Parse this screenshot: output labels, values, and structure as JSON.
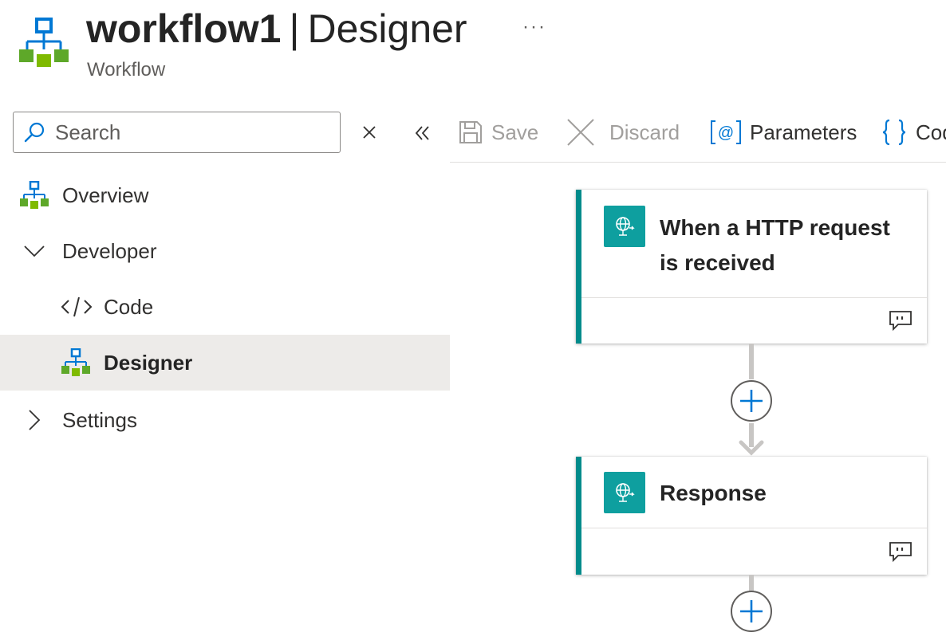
{
  "header": {
    "resource_name": "workflow1",
    "separator": "|",
    "page_name": "Designer",
    "more": "···",
    "subtitle": "Workflow"
  },
  "search": {
    "placeholder": "Search"
  },
  "nav": {
    "items": [
      {
        "label": "Overview",
        "icon": "workflow-icon"
      },
      {
        "label": "Developer",
        "icon": "chevron-down-icon",
        "expanded": true
      },
      {
        "label": "Code",
        "icon": "code-icon"
      },
      {
        "label": "Designer",
        "icon": "workflow-icon",
        "selected": true
      },
      {
        "label": "Settings",
        "icon": "chevron-right-icon",
        "expanded": false
      }
    ]
  },
  "toolbar": {
    "save_label": "Save",
    "discard_label": "Discard",
    "parameters_label": "Parameters",
    "code_label": "Code"
  },
  "canvas": {
    "trigger": {
      "title_line1": "When a HTTP request",
      "title_line2": "is received",
      "icon": "globe-request-icon"
    },
    "action": {
      "title": "Response",
      "icon": "globe-request-icon"
    }
  },
  "colors": {
    "accent": "#0078d4",
    "card_accent": "#008b8b",
    "card_icon_bg": "#0e9f9f",
    "selected_nav_bg": "#edebe9"
  }
}
